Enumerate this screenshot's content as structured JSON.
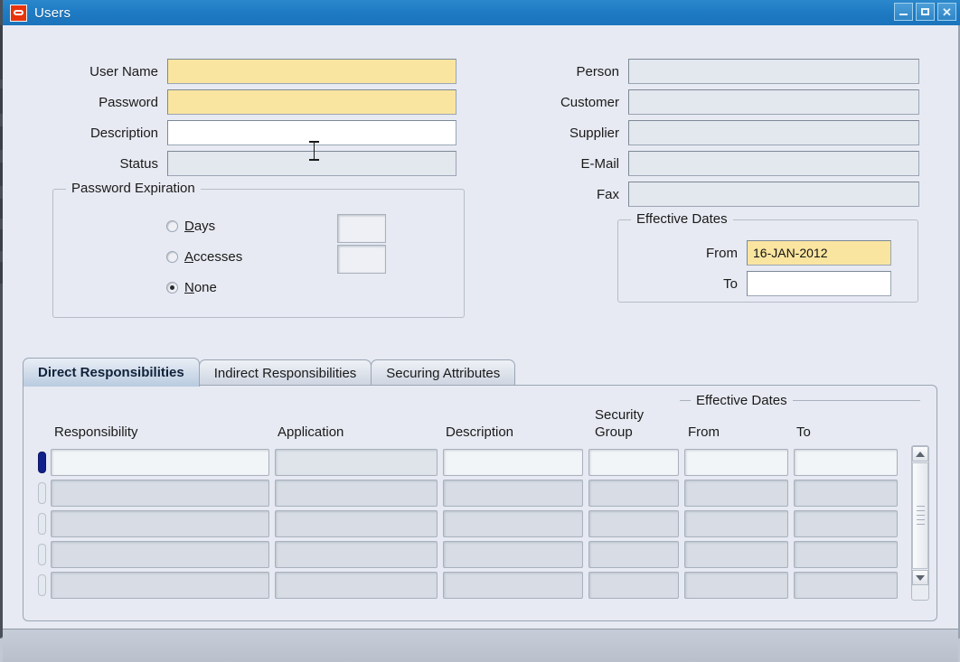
{
  "window": {
    "title": "Users",
    "logo_icon": "oracle-logo-icon",
    "controls": {
      "minimize": "minimize-icon",
      "maximize": "maximize-icon",
      "close": "close-icon"
    }
  },
  "colors": {
    "titlebar": "#1f7bc4",
    "background": "#e7eaf2",
    "required_field": "#fae5a0",
    "active_field": "#ffffff",
    "disabled_field": "#e3e7ee",
    "current_record_indicator": "#12208c",
    "bottom_chrome": "#c0c7d2"
  },
  "form": {
    "left_fields": [
      {
        "label": "User Name",
        "value": "",
        "state": "required"
      },
      {
        "label": "Password",
        "value": "",
        "state": "required"
      },
      {
        "label": "Description",
        "value": "",
        "state": "active"
      },
      {
        "label": "Status",
        "value": "",
        "state": "disabled"
      }
    ],
    "right_fields": [
      {
        "label": "Person",
        "value": "",
        "state": "disabled"
      },
      {
        "label": "Customer",
        "value": "",
        "state": "disabled"
      },
      {
        "label": "Supplier",
        "value": "",
        "state": "disabled"
      },
      {
        "label": "E-Mail",
        "value": "",
        "state": "disabled"
      },
      {
        "label": "Fax",
        "value": "",
        "state": "disabled"
      }
    ]
  },
  "password_expiration": {
    "title": "Password Expiration",
    "options": [
      {
        "label": "Days",
        "accel": "D",
        "selected": false,
        "value": ""
      },
      {
        "label": "Accesses",
        "accel": "A",
        "selected": false,
        "value": ""
      },
      {
        "label": "None",
        "accel": "N",
        "selected": true
      }
    ]
  },
  "effective_dates": {
    "title": "Effective Dates",
    "from": {
      "label": "From",
      "value": "16-JAN-2012",
      "state": "required"
    },
    "to": {
      "label": "To",
      "value": "",
      "state": "active"
    }
  },
  "tabs": [
    {
      "label": "Direct Responsibilities",
      "active": true
    },
    {
      "label": "Indirect Responsibilities",
      "active": false
    },
    {
      "label": "Securing Attributes",
      "active": false
    }
  ],
  "table": {
    "group_header": "Effective Dates",
    "columns": [
      {
        "label": "Responsibility"
      },
      {
        "label": "Application"
      },
      {
        "label": "Description"
      },
      {
        "label": "Security\nGroup"
      },
      {
        "label": "From"
      },
      {
        "label": "To"
      }
    ],
    "rows": [
      {
        "current": true,
        "cells": [
          "",
          "",
          "",
          "",
          "",
          ""
        ]
      },
      {
        "current": false,
        "cells": [
          "",
          "",
          "",
          "",
          "",
          ""
        ]
      },
      {
        "current": false,
        "cells": [
          "",
          "",
          "",
          "",
          "",
          ""
        ]
      },
      {
        "current": false,
        "cells": [
          "",
          "",
          "",
          "",
          "",
          ""
        ]
      },
      {
        "current": false,
        "cells": [
          "",
          "",
          "",
          "",
          "",
          ""
        ]
      }
    ]
  },
  "scrollbar": {
    "up_icon": "scroll-up-arrow-icon",
    "down_icon": "scroll-down-arrow-icon",
    "thumb": "scrollbar-thumb"
  }
}
